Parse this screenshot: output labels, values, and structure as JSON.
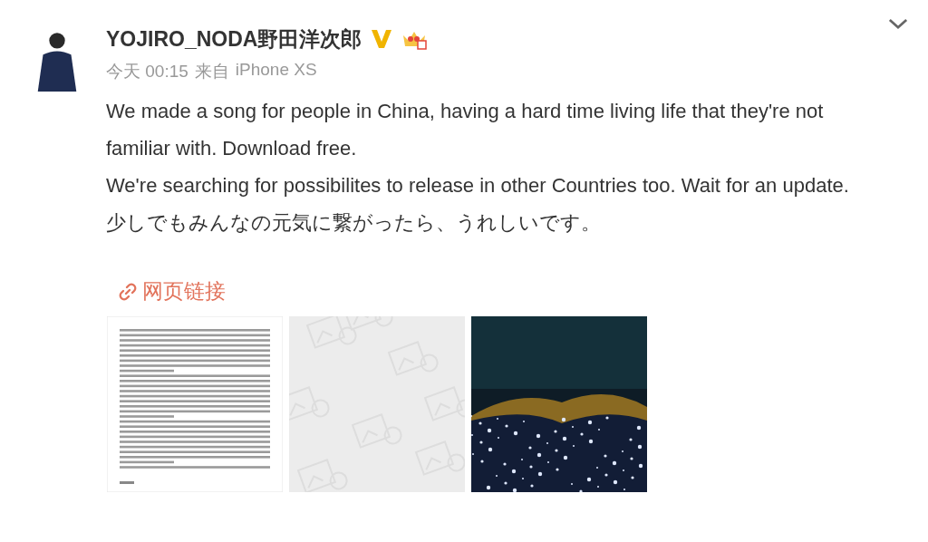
{
  "post": {
    "author": "YOJIRO_NODA野田洋次郎",
    "verified": true,
    "member": true,
    "time": "今天 00:15",
    "source_prefix": "来自",
    "source": "iPhone XS",
    "paragraphs": [
      "We made a song for people in China, having a hard time living life that they're not familiar with. Download free.",
      "We're searching for possibilites to release in other Countries too. Wait for an update.",
      "少しでもみんなの元気に繋がったら、うれしいです。"
    ],
    "link": "网页链接",
    "images": [
      {
        "kind": "document"
      },
      {
        "kind": "loading"
      },
      {
        "kind": "picture"
      }
    ]
  }
}
